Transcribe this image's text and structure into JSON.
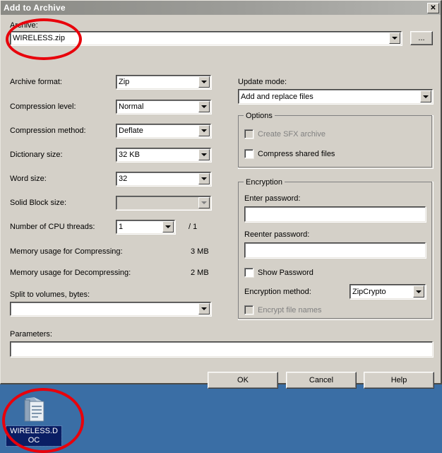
{
  "window": {
    "title": "Add to Archive",
    "close_label": "✕"
  },
  "archive": {
    "label": "Archive:",
    "value": "WIRELESS.zip",
    "browse_label": "...",
    "placeholder": ""
  },
  "left_column": {
    "archive_format": {
      "label": "Archive format:",
      "value": "Zip"
    },
    "compression_level": {
      "label": "Compression level:",
      "value": "Normal"
    },
    "compression_method": {
      "label": "Compression method:",
      "value": "Deflate"
    },
    "dictionary_size": {
      "label": "Dictionary size:",
      "value": "32 KB"
    },
    "word_size": {
      "label": "Word size:",
      "value": "32"
    },
    "solid_block_size": {
      "label": "Solid Block size:",
      "value": ""
    },
    "cpu_threads": {
      "label": "Number of CPU threads:",
      "value": "1",
      "total": "/ 1"
    },
    "memory_compress": {
      "label": "Memory usage for Compressing:",
      "value": "3 MB"
    },
    "memory_decompress": {
      "label": "Memory usage for Decompressing:",
      "value": "2 MB"
    },
    "split_volumes": {
      "label": "Split to volumes, bytes:",
      "value": ""
    },
    "parameters": {
      "label": "Parameters:",
      "value": ""
    }
  },
  "right_column": {
    "update_mode": {
      "label": "Update mode:",
      "value": "Add and replace files"
    },
    "options": {
      "title": "Options",
      "items": [
        {
          "label": "Create SFX archive",
          "checked": false,
          "disabled": true
        },
        {
          "label": "Compress shared files",
          "checked": false,
          "disabled": false
        }
      ]
    },
    "encryption": {
      "title": "Encryption",
      "enter_password_label": "Enter password:",
      "enter_password_value": "",
      "reenter_password_label": "Reenter password:",
      "reenter_password_value": "",
      "show_password": {
        "label": "Show Password",
        "checked": false,
        "disabled": false
      },
      "encryption_method": {
        "label": "Encryption method:",
        "value": "ZipCrypto"
      },
      "encrypt_file_names": {
        "label": "Encrypt file names",
        "checked": false,
        "disabled": true
      }
    }
  },
  "buttons": {
    "ok": "OK",
    "cancel": "Cancel",
    "help": "Help"
  },
  "desktop": {
    "icon_label": "WIRELESS.DOC",
    "background_color": "#3a6ea5"
  },
  "annotations": {
    "color": "#e8000b",
    "count": 2
  }
}
